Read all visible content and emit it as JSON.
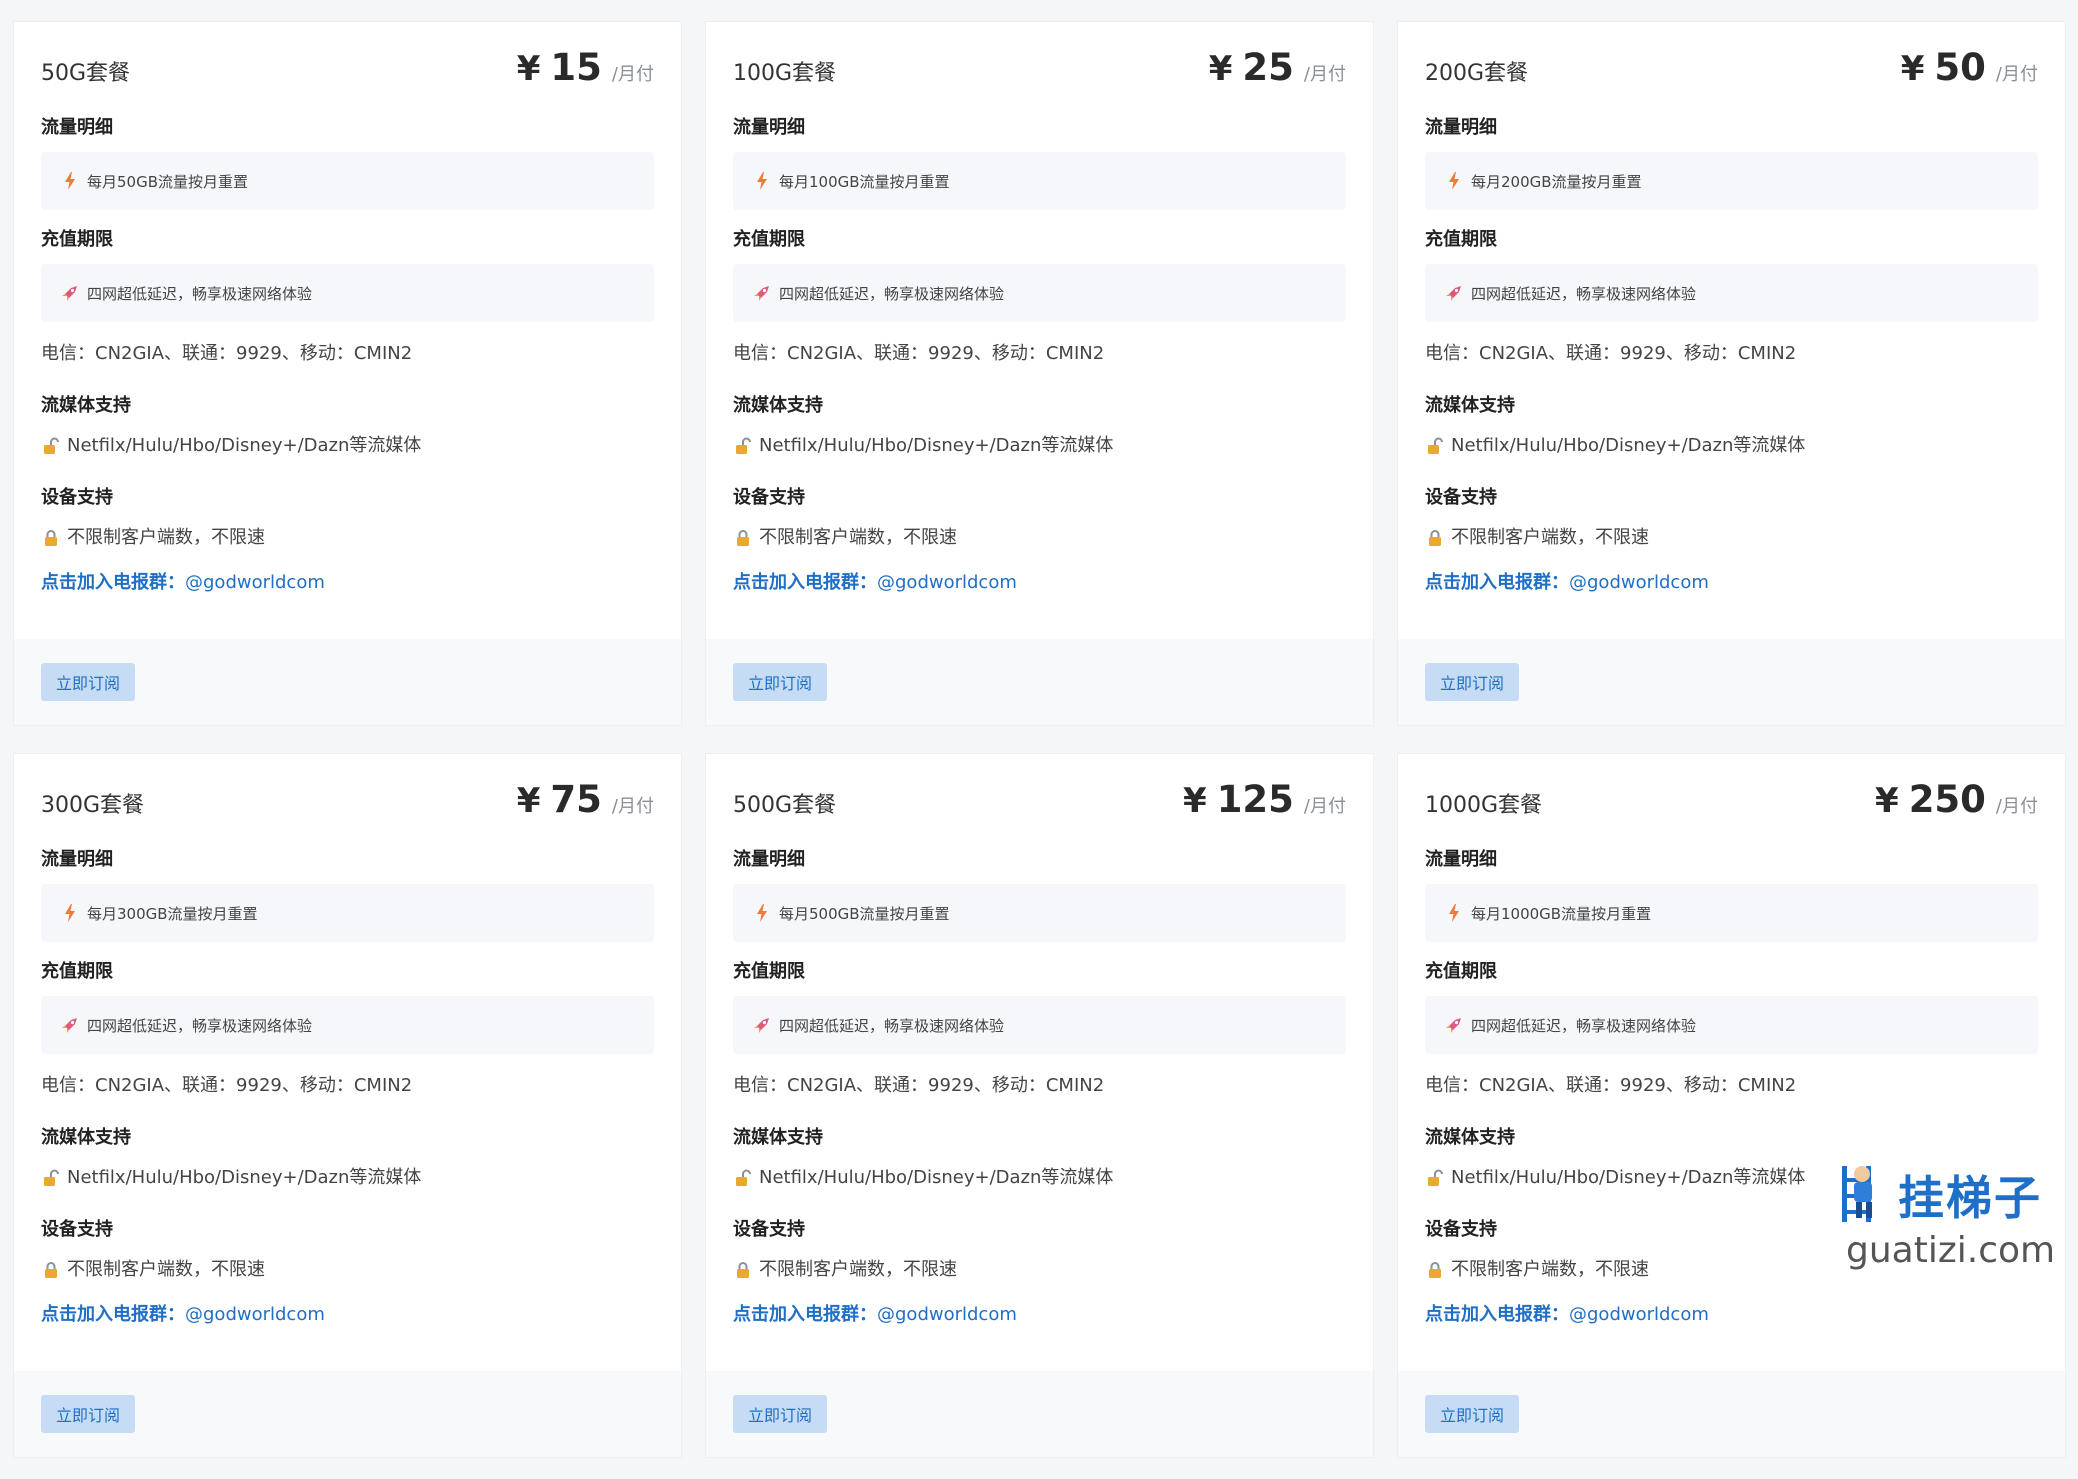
{
  "labels": {
    "traffic_title": "流量明细",
    "period_title": "充值期限",
    "period_desc": "四网超低延迟，畅享极速网络体验",
    "route_info": "电信：CN2GIA、联通：9929、移动：CMIN2",
    "stream_title": "流媒体支持",
    "stream_desc": "Netfilx/Hulu/Hbo/Disney+/Dazn等流媒体",
    "device_title": "设备支持",
    "device_desc": "不限制客户端数，不限速",
    "tg_label": "点击加入电报群：",
    "tg_handle": "@godworldcom",
    "subscribe": "立即订阅",
    "currency": "¥",
    "per_month": "/月付"
  },
  "plans": [
    {
      "name": "50G套餐",
      "price": "15",
      "traffic": "每月50GB流量按月重置"
    },
    {
      "name": "100G套餐",
      "price": "25",
      "traffic": "每月100GB流量按月重置"
    },
    {
      "name": "200G套餐",
      "price": "50",
      "traffic": "每月200GB流量按月重置"
    },
    {
      "name": "300G套餐",
      "price": "75",
      "traffic": "每月300GB流量按月重置"
    },
    {
      "name": "500G套餐",
      "price": "125",
      "traffic": "每月500GB流量按月重置"
    },
    {
      "name": "1000G套餐",
      "price": "250",
      "traffic": "每月1000GB流量按月重置"
    }
  ],
  "icons": {
    "traffic": "lightning-icon",
    "period": "rocket-icon",
    "stream": "unlock-icon",
    "device": "lock-icon"
  },
  "colors": {
    "link": "#1f6fc6",
    "button_bg": "#c5dcf4",
    "lightning": "#f07a3a"
  },
  "watermark": {
    "cn": "挂梯子",
    "en": "guatizi.com"
  }
}
